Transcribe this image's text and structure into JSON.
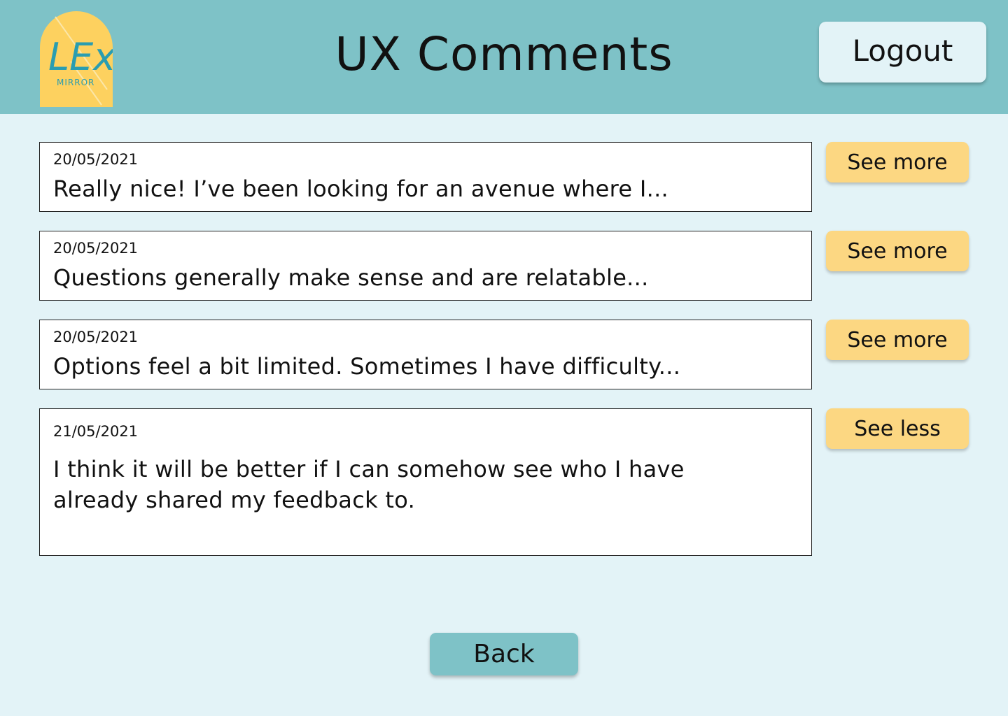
{
  "header": {
    "logo": {
      "main_text": "LEx",
      "sub_text": "MIRROR"
    },
    "title": "UX Comments",
    "logout_label": "Logout"
  },
  "comments": [
    {
      "date": "20/05/2021",
      "text": "Really nice! I’ve been looking for an avenue where I...",
      "toggle_label": "See more",
      "expanded": false
    },
    {
      "date": "20/05/2021",
      "text": "Questions generally make sense and are relatable...",
      "toggle_label": "See more",
      "expanded": false
    },
    {
      "date": "20/05/2021",
      "text": "Options feel a bit limited. Sometimes I have difficulty...",
      "toggle_label": "See more",
      "expanded": false
    },
    {
      "date": "21/05/2021",
      "text": "I think it will be better if I can somehow see who I have already shared my feedback to.",
      "toggle_label": "See less",
      "expanded": true
    }
  ],
  "footer": {
    "back_label": "Back"
  },
  "colors": {
    "header_bg": "#7ec2c7",
    "page_bg": "#e3f3f7",
    "toggle_button": "#fcd782",
    "logo_bg": "#fdd15f",
    "logo_text": "#2a9db0"
  }
}
